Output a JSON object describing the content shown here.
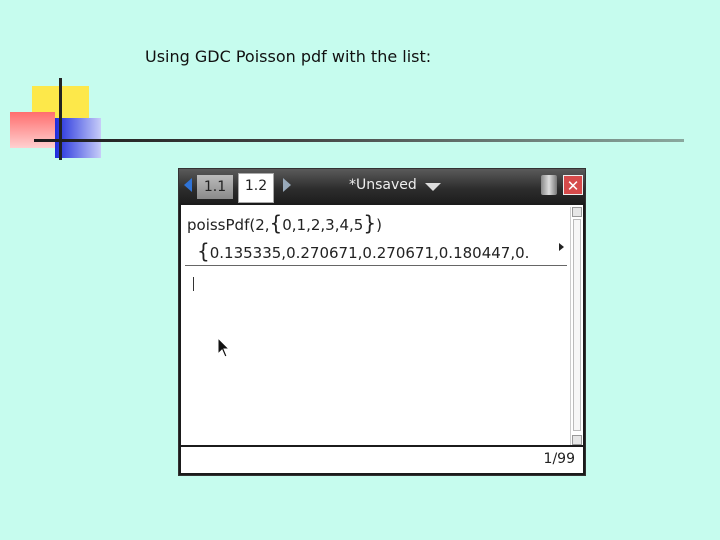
{
  "slide": {
    "title": "Using GDC Poisson pdf with the list:"
  },
  "calc": {
    "tabs": [
      {
        "label": "1.1"
      },
      {
        "label": "1.2"
      }
    ],
    "doc_title": "*Unsaved",
    "close_label": "✕",
    "entry": {
      "func": "poissPdf",
      "open": "(2,",
      "list": "0,1,2,3,4,5",
      "close": ")"
    },
    "result": "0.135335,0.270671,0.270671,0.180447,0.",
    "page_count": "1/99"
  },
  "colors": {
    "background": "#c6fcee",
    "accent": "#2f73d6",
    "close": "#d64b4b"
  }
}
